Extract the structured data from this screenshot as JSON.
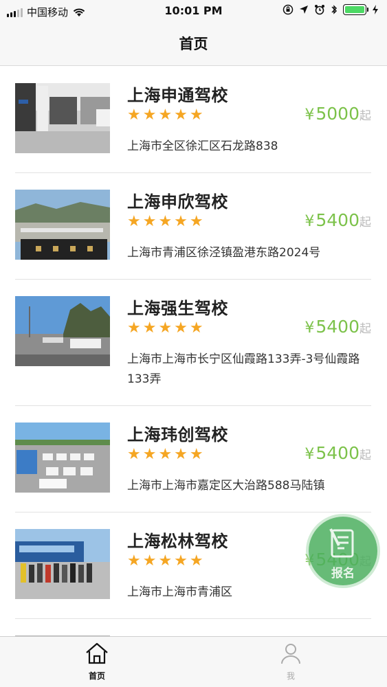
{
  "status_bar": {
    "carrier": "中国移动",
    "time": "10:01 PM",
    "icons": [
      "signal-icon",
      "wifi-icon",
      "orientation-lock-icon",
      "location-icon",
      "alarm-icon",
      "bluetooth-icon",
      "battery-icon",
      "charging-icon"
    ]
  },
  "nav": {
    "title": "首页"
  },
  "schools": [
    {
      "name": "上海申通驾校",
      "rating": 5,
      "stars": "★★★★★",
      "currency": "¥",
      "price": "5000",
      "price_suffix": "起",
      "address": "上海市全区徐汇区石龙路838"
    },
    {
      "name": "上海申欣驾校",
      "rating": 5,
      "stars": "★★★★★",
      "currency": "¥",
      "price": "5400",
      "price_suffix": "起",
      "address": "上海市青浦区徐泾镇盈港东路2024号"
    },
    {
      "name": "上海强生驾校",
      "rating": 5,
      "stars": "★★★★★",
      "currency": "¥",
      "price": "5400",
      "price_suffix": "起",
      "address": "上海市上海市长宁区仙霞路133弄-3号仙霞路133弄"
    },
    {
      "name": "上海玮创驾校",
      "rating": 5,
      "stars": "★★★★★",
      "currency": "¥",
      "price": "5400",
      "price_suffix": "起",
      "address": "上海市上海市嘉定区大治路588马陆镇"
    },
    {
      "name": "上海松林驾校",
      "rating": 5,
      "stars": "★★★★★",
      "currency": "¥",
      "price": "5400",
      "price_suffix": "起",
      "address": "上海市上海市青浦区"
    }
  ],
  "fab": {
    "label": "报名",
    "icon": "signup-form-icon"
  },
  "tabs": [
    {
      "label": "首页",
      "icon": "home-icon",
      "active": true
    },
    {
      "label": "我",
      "icon": "user-icon",
      "active": false
    }
  ],
  "colors": {
    "price_green": "#7cc24a",
    "star_orange": "#f5a623",
    "fab_green": "#4caf5f"
  }
}
